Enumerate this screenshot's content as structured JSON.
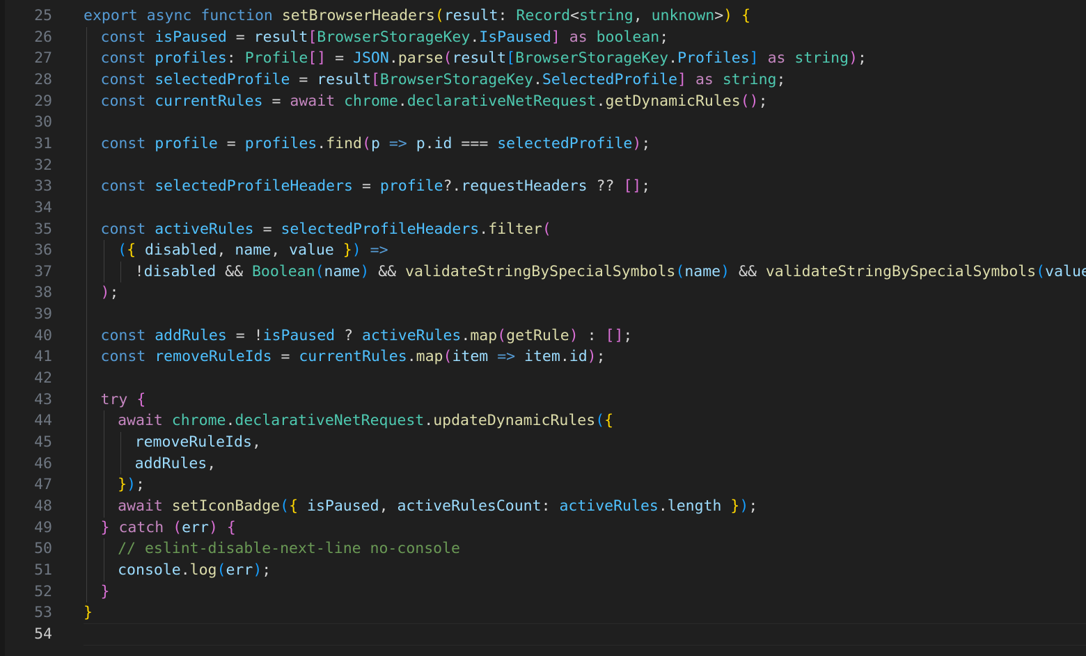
{
  "editor": {
    "current_line": "54",
    "lines": [
      {
        "n": "25",
        "indent": 0,
        "tokens": [
          [
            "kw",
            "export"
          ],
          [
            "op",
            " "
          ],
          [
            "kw",
            "async"
          ],
          [
            "op",
            " "
          ],
          [
            "kw",
            "function"
          ],
          [
            "op",
            " "
          ],
          [
            "fn",
            "setBrowserHeaders"
          ],
          [
            "b1",
            "("
          ],
          [
            "vr",
            "result"
          ],
          [
            "op",
            ": "
          ],
          [
            "ty",
            "Record"
          ],
          [
            "op",
            "<"
          ],
          [
            "ty",
            "string"
          ],
          [
            "op",
            ", "
          ],
          [
            "ty",
            "unknown"
          ],
          [
            "op",
            ">"
          ],
          [
            "b1",
            ")"
          ],
          [
            "op",
            " "
          ],
          [
            "b1",
            "{"
          ]
        ]
      },
      {
        "n": "26",
        "indent": 1,
        "tokens": [
          [
            "kw",
            "const"
          ],
          [
            "op",
            " "
          ],
          [
            "cst",
            "isPaused"
          ],
          [
            "op",
            " = "
          ],
          [
            "vr",
            "result"
          ],
          [
            "b2",
            "["
          ],
          [
            "ty",
            "BrowserStorageKey"
          ],
          [
            "op",
            "."
          ],
          [
            "cst",
            "IsPaused"
          ],
          [
            "b2",
            "]"
          ],
          [
            "op",
            " "
          ],
          [
            "ctl",
            "as"
          ],
          [
            "op",
            " "
          ],
          [
            "ty",
            "boolean"
          ],
          [
            "op",
            ";"
          ]
        ]
      },
      {
        "n": "27",
        "indent": 1,
        "tokens": [
          [
            "kw",
            "const"
          ],
          [
            "op",
            " "
          ],
          [
            "cst",
            "profiles"
          ],
          [
            "op",
            ": "
          ],
          [
            "ty",
            "Profile"
          ],
          [
            "b2",
            "[]"
          ],
          [
            "op",
            " = "
          ],
          [
            "cst",
            "JSON"
          ],
          [
            "op",
            "."
          ],
          [
            "fn",
            "parse"
          ],
          [
            "b2",
            "("
          ],
          [
            "vr",
            "result"
          ],
          [
            "b3",
            "["
          ],
          [
            "ty",
            "BrowserStorageKey"
          ],
          [
            "op",
            "."
          ],
          [
            "cst",
            "Profiles"
          ],
          [
            "b3",
            "]"
          ],
          [
            "op",
            " "
          ],
          [
            "ctl",
            "as"
          ],
          [
            "op",
            " "
          ],
          [
            "ty",
            "string"
          ],
          [
            "b2",
            ")"
          ],
          [
            "op",
            ";"
          ]
        ]
      },
      {
        "n": "28",
        "indent": 1,
        "tokens": [
          [
            "kw",
            "const"
          ],
          [
            "op",
            " "
          ],
          [
            "cst",
            "selectedProfile"
          ],
          [
            "op",
            " = "
          ],
          [
            "vr",
            "result"
          ],
          [
            "b2",
            "["
          ],
          [
            "ty",
            "BrowserStorageKey"
          ],
          [
            "op",
            "."
          ],
          [
            "cst",
            "SelectedProfile"
          ],
          [
            "b2",
            "]"
          ],
          [
            "op",
            " "
          ],
          [
            "ctl",
            "as"
          ],
          [
            "op",
            " "
          ],
          [
            "ty",
            "string"
          ],
          [
            "op",
            ";"
          ]
        ]
      },
      {
        "n": "29",
        "indent": 1,
        "tokens": [
          [
            "kw",
            "const"
          ],
          [
            "op",
            " "
          ],
          [
            "cst",
            "currentRules"
          ],
          [
            "op",
            " = "
          ],
          [
            "ctl",
            "await"
          ],
          [
            "op",
            " "
          ],
          [
            "ty",
            "chrome"
          ],
          [
            "op",
            "."
          ],
          [
            "ty",
            "declarativeNetRequest"
          ],
          [
            "op",
            "."
          ],
          [
            "fn",
            "getDynamicRules"
          ],
          [
            "b2",
            "()"
          ],
          [
            "op",
            ";"
          ]
        ]
      },
      {
        "n": "30",
        "indent": 1,
        "tokens": []
      },
      {
        "n": "31",
        "indent": 1,
        "tokens": [
          [
            "kw",
            "const"
          ],
          [
            "op",
            " "
          ],
          [
            "cst",
            "profile"
          ],
          [
            "op",
            " = "
          ],
          [
            "cst",
            "profiles"
          ],
          [
            "op",
            "."
          ],
          [
            "fn",
            "find"
          ],
          [
            "b2",
            "("
          ],
          [
            "vr",
            "p"
          ],
          [
            "op",
            " "
          ],
          [
            "kw",
            "=>"
          ],
          [
            "op",
            " "
          ],
          [
            "vr",
            "p"
          ],
          [
            "op",
            "."
          ],
          [
            "vr",
            "id"
          ],
          [
            "op",
            " === "
          ],
          [
            "cst",
            "selectedProfile"
          ],
          [
            "b2",
            ")"
          ],
          [
            "op",
            ";"
          ]
        ]
      },
      {
        "n": "32",
        "indent": 1,
        "tokens": []
      },
      {
        "n": "33",
        "indent": 1,
        "tokens": [
          [
            "kw",
            "const"
          ],
          [
            "op",
            " "
          ],
          [
            "cst",
            "selectedProfileHeaders"
          ],
          [
            "op",
            " = "
          ],
          [
            "cst",
            "profile"
          ],
          [
            "op",
            "?."
          ],
          [
            "vr",
            "requestHeaders"
          ],
          [
            "op",
            " ?? "
          ],
          [
            "b2",
            "[]"
          ],
          [
            "op",
            ";"
          ]
        ]
      },
      {
        "n": "34",
        "indent": 1,
        "tokens": []
      },
      {
        "n": "35",
        "indent": 1,
        "tokens": [
          [
            "kw",
            "const"
          ],
          [
            "op",
            " "
          ],
          [
            "cst",
            "activeRules"
          ],
          [
            "op",
            " = "
          ],
          [
            "cst",
            "selectedProfileHeaders"
          ],
          [
            "op",
            "."
          ],
          [
            "fn",
            "filter"
          ],
          [
            "b2",
            "("
          ]
        ]
      },
      {
        "n": "36",
        "indent": 2,
        "tokens": [
          [
            "b3",
            "("
          ],
          [
            "b1",
            "{"
          ],
          [
            "op",
            " "
          ],
          [
            "vr",
            "disabled"
          ],
          [
            "op",
            ", "
          ],
          [
            "vr",
            "name"
          ],
          [
            "op",
            ", "
          ],
          [
            "vr",
            "value"
          ],
          [
            "op",
            " "
          ],
          [
            "b1",
            "}"
          ],
          [
            "b3",
            ")"
          ],
          [
            "op",
            " "
          ],
          [
            "kw",
            "=>"
          ]
        ]
      },
      {
        "n": "37",
        "indent": 3,
        "tokens": [
          [
            "op",
            "!"
          ],
          [
            "vr",
            "disabled"
          ],
          [
            "op",
            " && "
          ],
          [
            "ty",
            "Boolean"
          ],
          [
            "b3",
            "("
          ],
          [
            "vr",
            "name"
          ],
          [
            "b3",
            ")"
          ],
          [
            "op",
            " && "
          ],
          [
            "fn",
            "validateStringBySpecialSymbols"
          ],
          [
            "b3",
            "("
          ],
          [
            "vr",
            "name"
          ],
          [
            "b3",
            ")"
          ],
          [
            "op",
            " && "
          ],
          [
            "fn",
            "validateStringBySpecialSymbols"
          ],
          [
            "b3",
            "("
          ],
          [
            "vr",
            "value"
          ],
          [
            "b3",
            ")"
          ],
          [
            "op",
            ","
          ]
        ]
      },
      {
        "n": "38",
        "indent": 1,
        "tokens": [
          [
            "b2",
            ")"
          ],
          [
            "op",
            ";"
          ]
        ]
      },
      {
        "n": "39",
        "indent": 1,
        "tokens": []
      },
      {
        "n": "40",
        "indent": 1,
        "tokens": [
          [
            "kw",
            "const"
          ],
          [
            "op",
            " "
          ],
          [
            "cst",
            "addRules"
          ],
          [
            "op",
            " = !"
          ],
          [
            "cst",
            "isPaused"
          ],
          [
            "op",
            " ? "
          ],
          [
            "cst",
            "activeRules"
          ],
          [
            "op",
            "."
          ],
          [
            "fn",
            "map"
          ],
          [
            "b2",
            "("
          ],
          [
            "fn",
            "getRule"
          ],
          [
            "b2",
            ")"
          ],
          [
            "op",
            " : "
          ],
          [
            "b2",
            "[]"
          ],
          [
            "op",
            ";"
          ]
        ]
      },
      {
        "n": "41",
        "indent": 1,
        "tokens": [
          [
            "kw",
            "const"
          ],
          [
            "op",
            " "
          ],
          [
            "cst",
            "removeRuleIds"
          ],
          [
            "op",
            " = "
          ],
          [
            "cst",
            "currentRules"
          ],
          [
            "op",
            "."
          ],
          [
            "fn",
            "map"
          ],
          [
            "b2",
            "("
          ],
          [
            "vr",
            "item"
          ],
          [
            "op",
            " "
          ],
          [
            "kw",
            "=>"
          ],
          [
            "op",
            " "
          ],
          [
            "vr",
            "item"
          ],
          [
            "op",
            "."
          ],
          [
            "vr",
            "id"
          ],
          [
            "b2",
            ")"
          ],
          [
            "op",
            ";"
          ]
        ]
      },
      {
        "n": "42",
        "indent": 1,
        "tokens": []
      },
      {
        "n": "43",
        "indent": 1,
        "tokens": [
          [
            "ctl",
            "try"
          ],
          [
            "op",
            " "
          ],
          [
            "b2",
            "{"
          ]
        ]
      },
      {
        "n": "44",
        "indent": 2,
        "tokens": [
          [
            "ctl",
            "await"
          ],
          [
            "op",
            " "
          ],
          [
            "ty",
            "chrome"
          ],
          [
            "op",
            "."
          ],
          [
            "ty",
            "declarativeNetRequest"
          ],
          [
            "op",
            "."
          ],
          [
            "fn",
            "updateDynamicRules"
          ],
          [
            "b3",
            "("
          ],
          [
            "b1",
            "{"
          ]
        ]
      },
      {
        "n": "45",
        "indent": 3,
        "tokens": [
          [
            "vr",
            "removeRuleIds"
          ],
          [
            "op",
            ","
          ]
        ]
      },
      {
        "n": "46",
        "indent": 3,
        "tokens": [
          [
            "vr",
            "addRules"
          ],
          [
            "op",
            ","
          ]
        ]
      },
      {
        "n": "47",
        "indent": 2,
        "tokens": [
          [
            "b1",
            "}"
          ],
          [
            "b3",
            ")"
          ],
          [
            "op",
            ";"
          ]
        ]
      },
      {
        "n": "48",
        "indent": 2,
        "tokens": [
          [
            "ctl",
            "await"
          ],
          [
            "op",
            " "
          ],
          [
            "fn",
            "setIconBadge"
          ],
          [
            "b3",
            "("
          ],
          [
            "b1",
            "{"
          ],
          [
            "op",
            " "
          ],
          [
            "vr",
            "isPaused"
          ],
          [
            "op",
            ", "
          ],
          [
            "vr",
            "activeRulesCount"
          ],
          [
            "op",
            ": "
          ],
          [
            "cst",
            "activeRules"
          ],
          [
            "op",
            "."
          ],
          [
            "vr",
            "length"
          ],
          [
            "op",
            " "
          ],
          [
            "b1",
            "}"
          ],
          [
            "b3",
            ")"
          ],
          [
            "op",
            ";"
          ]
        ]
      },
      {
        "n": "49",
        "indent": 1,
        "tokens": [
          [
            "b2",
            "}"
          ],
          [
            "op",
            " "
          ],
          [
            "ctl",
            "catch"
          ],
          [
            "op",
            " "
          ],
          [
            "b2",
            "("
          ],
          [
            "vr",
            "err"
          ],
          [
            "b2",
            ")"
          ],
          [
            "op",
            " "
          ],
          [
            "b2",
            "{"
          ]
        ]
      },
      {
        "n": "50",
        "indent": 2,
        "tokens": [
          [
            "cm",
            "// eslint-disable-next-line no-console"
          ]
        ]
      },
      {
        "n": "51",
        "indent": 2,
        "tokens": [
          [
            "vr",
            "console"
          ],
          [
            "op",
            "."
          ],
          [
            "fn",
            "log"
          ],
          [
            "b3",
            "("
          ],
          [
            "vr",
            "err"
          ],
          [
            "b3",
            ")"
          ],
          [
            "op",
            ";"
          ]
        ]
      },
      {
        "n": "52",
        "indent": 1,
        "tokens": [
          [
            "b2",
            "}"
          ]
        ]
      },
      {
        "n": "53",
        "indent": 0,
        "tokens": [
          [
            "b1",
            "}"
          ]
        ]
      },
      {
        "n": "54",
        "indent": 0,
        "tokens": []
      }
    ]
  }
}
